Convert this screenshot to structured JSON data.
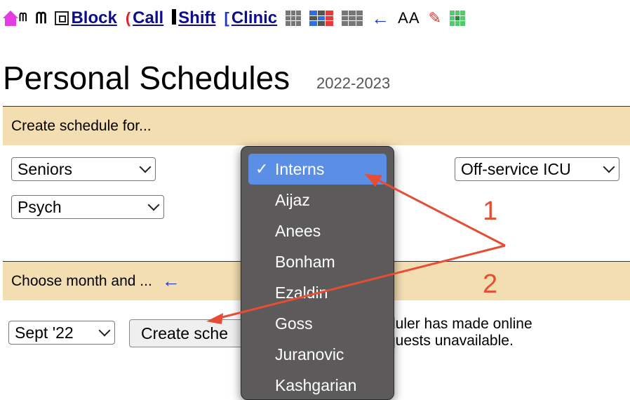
{
  "nav": {
    "block_label": "Block",
    "call_label": "Call",
    "shift_label": "Shift",
    "clinic_label": "Clinic",
    "font_size_label": "AA"
  },
  "page": {
    "title": "Personal Schedules",
    "year": "2022-2023"
  },
  "section1": {
    "heading": "Create schedule for...",
    "select_seniors": "Seniors",
    "select_psych": "Psych",
    "select_offservice": "Off-service ICU"
  },
  "section2": {
    "heading": "Choose month and ...",
    "month": "Sept '22",
    "create_button": "Create sche",
    "note_line1": "duler has made online",
    "note_line2": "quests unavailable."
  },
  "dropdown": {
    "selected": "Interns",
    "items": [
      "Aijaz",
      "Anees",
      "Bonham",
      "Ezaldin",
      "Goss",
      "Juranovic",
      "Kashgarian"
    ]
  },
  "annotations": {
    "label1": "1",
    "label2": "2",
    "color": "#e74d35"
  },
  "colors": {
    "section_bg": "#f3deb2",
    "link": "#0d0d8c",
    "highlight": "#5b8ee5"
  }
}
